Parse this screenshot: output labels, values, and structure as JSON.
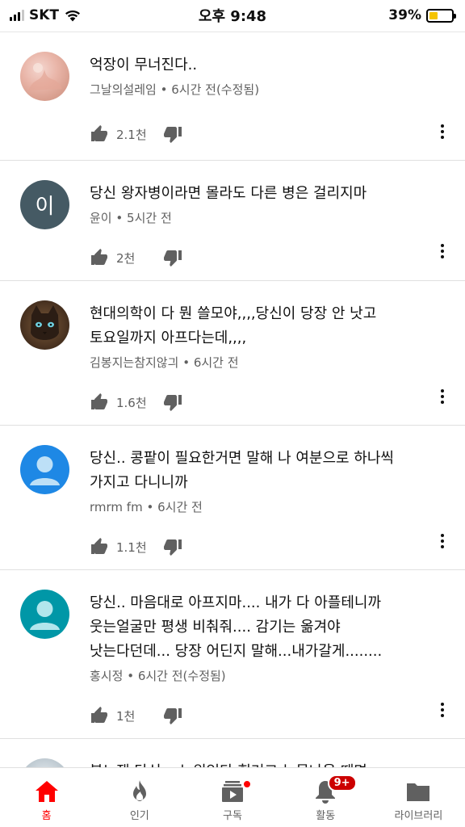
{
  "status": {
    "carrier": "SKT",
    "time": "오후 9:48",
    "battery_percent": "39%",
    "battery_level": 0.39,
    "battery_color": "#f5c400"
  },
  "comments": [
    {
      "text": "억장이 무너진다..",
      "author": "그날의설레임",
      "time": "6시간 전(수정됨)",
      "likes": "2.1천",
      "avatar": "photo-avatar"
    },
    {
      "text": "당신 왕자병이라면 몰라도 다른 병은 걸리지마",
      "author": "윤이",
      "time": "5시간 전",
      "likes": "2천",
      "avatar_letter": "이"
    },
    {
      "text": "현대의학이 다 뭔 쓸모야,,,,당신이 당장 안 낫고\n토요일까지 아프다는데,,,,",
      "author": "김봉지는참지않긔",
      "time": "6시간 전",
      "likes": "1.6천",
      "avatar": "cat-photo-avatar"
    },
    {
      "text": "당신.. 콩팥이 필요한거면 말해 나 여분으로 하나씩\n가지고 다니니까",
      "author": "rmrm fm",
      "time": "6시간 전",
      "likes": "1.1천",
      "avatar": "default-person-avatar"
    },
    {
      "text": "당신.. 마음대로 아프지마.... 내가 다 아플테니까\n웃는얼굴만 평생 비춰줘.... 감기는 옮겨야\n낫는다던데... 당장 어딘지 말해...내가갈게........",
      "author": "홍시정",
      "time": "6시간 전(수정됨)",
      "likes": "1천",
      "avatar": "default-person-avatar"
    },
    {
      "text": "봇노잼 당신... 누워있다 힘겨고 눈물나올 때면",
      "avatar": "photo-avatar"
    }
  ],
  "meta_separator": "•",
  "nav": [
    {
      "label": "홈",
      "icon": "home-icon",
      "active": true
    },
    {
      "label": "인기",
      "icon": "fire-icon"
    },
    {
      "label": "구독",
      "icon": "subscriptions-icon"
    },
    {
      "label": "활동",
      "icon": "bell-icon",
      "badge": "9+"
    },
    {
      "label": "라이브러리",
      "icon": "folder-icon"
    }
  ],
  "colors": {
    "accent": "#ff0000",
    "badge": "#cc0000",
    "meta_text": "#606060"
  }
}
